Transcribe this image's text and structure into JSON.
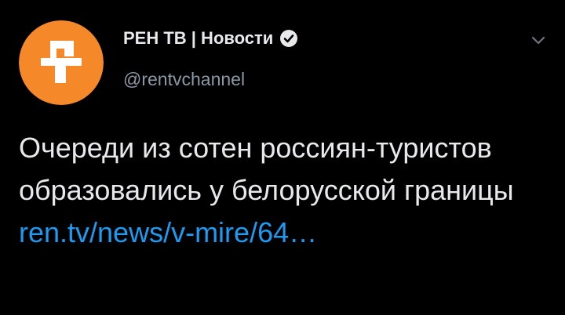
{
  "tweet": {
    "display_name": "РЕН ТВ | Новости",
    "handle": "@rentvchannel",
    "text": "Очереди из сотен россиян-туристов образовались у белорусской границы",
    "link": "ren.tv/news/v-mire/64…"
  },
  "icons": {
    "avatar": "rentv-logo",
    "verified": "verified-badge-icon",
    "menu": "chevron-down-icon"
  },
  "colors": {
    "background": "#000000",
    "link": "#1d9bf0",
    "avatar_orange": "#f5892a",
    "secondary_text": "#8b98a5"
  }
}
